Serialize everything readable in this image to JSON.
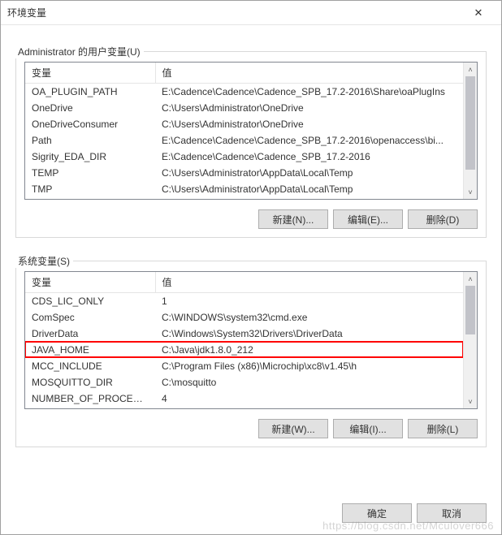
{
  "window": {
    "title": "环境变量"
  },
  "user": {
    "label": "Administrator 的用户变量(U)",
    "header_var": "变量",
    "header_val": "值",
    "rows": [
      {
        "var": "OA_PLUGIN_PATH",
        "val": "E:\\Cadence\\Cadence\\Cadence_SPB_17.2-2016\\Share\\oaPlugIns"
      },
      {
        "var": "OneDrive",
        "val": "C:\\Users\\Administrator\\OneDrive"
      },
      {
        "var": "OneDriveConsumer",
        "val": "C:\\Users\\Administrator\\OneDrive"
      },
      {
        "var": "Path",
        "val": "E:\\Cadence\\Cadence\\Cadence_SPB_17.2-2016\\openaccess\\bi..."
      },
      {
        "var": "Sigrity_EDA_DIR",
        "val": "E:\\Cadence\\Cadence\\Cadence_SPB_17.2-2016"
      },
      {
        "var": "TEMP",
        "val": "C:\\Users\\Administrator\\AppData\\Local\\Temp"
      },
      {
        "var": "TMP",
        "val": "C:\\Users\\Administrator\\AppData\\Local\\Temp"
      }
    ],
    "btn_new": "新建(N)...",
    "btn_edit": "编辑(E)...",
    "btn_delete": "删除(D)"
  },
  "system": {
    "label": "系统变量(S)",
    "header_var": "变量",
    "header_val": "值",
    "rows": [
      {
        "var": "CDS_LIC_ONLY",
        "val": "1"
      },
      {
        "var": "ComSpec",
        "val": "C:\\WINDOWS\\system32\\cmd.exe"
      },
      {
        "var": "DriverData",
        "val": "C:\\Windows\\System32\\Drivers\\DriverData"
      },
      {
        "var": "JAVA_HOME",
        "val": "C:\\Java\\jdk1.8.0_212"
      },
      {
        "var": "MCC_INCLUDE",
        "val": "C:\\Program Files (x86)\\Microchip\\xc8\\v1.45\\h"
      },
      {
        "var": "MOSQUITTO_DIR",
        "val": "C:\\mosquitto"
      },
      {
        "var": "NUMBER_OF_PROCESSORS",
        "val": "4"
      }
    ],
    "highlight_index": 3,
    "btn_new": "新建(W)...",
    "btn_edit": "编辑(I)...",
    "btn_delete": "删除(L)"
  },
  "footer": {
    "ok": "确定",
    "cancel": "取消"
  },
  "watermark": "https://blog.csdn.net/Mculover666"
}
